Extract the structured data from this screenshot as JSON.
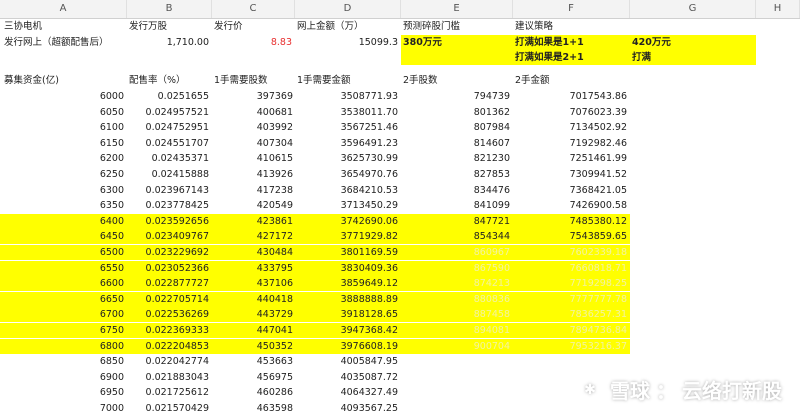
{
  "columns": [
    "A",
    "B",
    "C",
    "D",
    "E",
    "F",
    "G",
    "H"
  ],
  "row1": {
    "a": "三协电机",
    "b": "发行万股",
    "c": "发行价",
    "d": "网上金额（万）",
    "e": "预测碎股门槛",
    "f": "建议策略"
  },
  "row2": {
    "a": "发行网上（超额配售后）",
    "b": "1,710.00",
    "c": "8.83",
    "d": "15099.3",
    "e": "380万元",
    "f": "打满如果是1+1",
    "g": "420万元"
  },
  "row3": {
    "f": "打满如果是2+1",
    "g": "打满"
  },
  "table_header": {
    "a": "募集资金(亿)",
    "b": "配售率（%）",
    "c": "1手需要股数",
    "d": "1手需要金额",
    "e": "2手股数",
    "f": "2手金额"
  },
  "table_rows": [
    [
      "6000",
      "0.0251655",
      "397369",
      "3508771.93",
      "794739",
      "7017543.86"
    ],
    [
      "6050",
      "0.024957521",
      "400681",
      "3538011.70",
      "801362",
      "7076023.39"
    ],
    [
      "6100",
      "0.024752951",
      "403992",
      "3567251.46",
      "807984",
      "7134502.92"
    ],
    [
      "6150",
      "0.024551707",
      "407304",
      "3596491.23",
      "814607",
      "7192982.46"
    ],
    [
      "6200",
      "0.02435371",
      "410615",
      "3625730.99",
      "821230",
      "7251461.99"
    ],
    [
      "6250",
      "0.02415888",
      "413926",
      "3654970.76",
      "827853",
      "7309941.52"
    ],
    [
      "6300",
      "0.023967143",
      "417238",
      "3684210.53",
      "834476",
      "7368421.05"
    ],
    [
      "6350",
      "0.023778425",
      "420549",
      "3713450.29",
      "841099",
      "7426900.58"
    ],
    [
      "6400",
      "0.023592656",
      "423861",
      "3742690.06",
      "847721",
      "7485380.12"
    ],
    [
      "6450",
      "0.023409767",
      "427172",
      "3771929.82",
      "854344",
      "7543859.65"
    ],
    [
      "6500",
      "0.023229692",
      "430484",
      "3801169.59",
      "860967",
      "7602339.18"
    ],
    [
      "6550",
      "0.023052366",
      "433795",
      "3830409.36",
      "867590",
      "7660818.71"
    ],
    [
      "6600",
      "0.022877727",
      "437106",
      "3859649.12",
      "874213",
      "7719298.25"
    ],
    [
      "6650",
      "0.022705714",
      "440418",
      "3888888.89",
      "880836",
      "7777777.78"
    ],
    [
      "6700",
      "0.022536269",
      "443729",
      "3918128.65",
      "887458",
      "7836257.31"
    ],
    [
      "6750",
      "0.022369333",
      "447041",
      "3947368.42",
      "894081",
      "7894736.84"
    ],
    [
      "6800",
      "0.022204853",
      "450352",
      "3976608.19",
      "900704",
      "7953216.37"
    ],
    [
      "6850",
      "0.022042774",
      "453663",
      "4005847.95",
      "",
      ""
    ],
    [
      "6900",
      "0.021883043",
      "456975",
      "4035087.72",
      "",
      ""
    ],
    [
      "6950",
      "0.021725612",
      "460286",
      "4064327.49",
      "",
      ""
    ],
    [
      "7000",
      "0.021570429",
      "463598",
      "4093567.25",
      "",
      ""
    ]
  ],
  "watermark": {
    "brand": "雪球",
    "sep": "：",
    "author": "云络打新股"
  }
}
